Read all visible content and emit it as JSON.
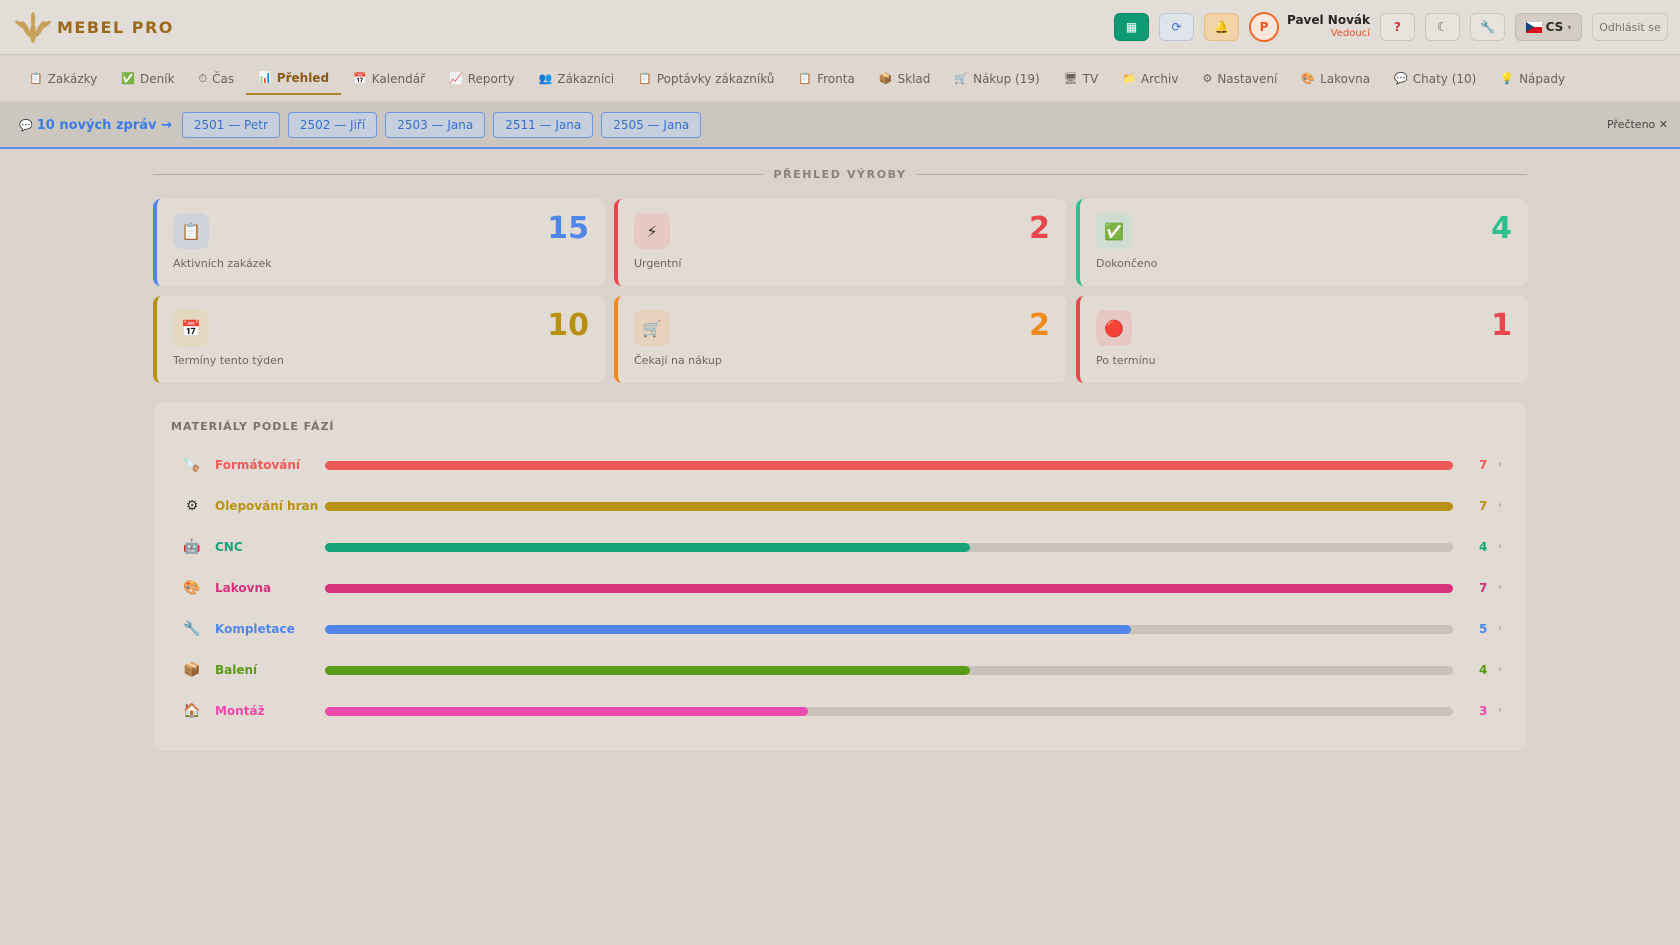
{
  "app": {
    "name": "MEBEL PRO",
    "brand_color": "#9a6a1e"
  },
  "header": {
    "buttons": [
      {
        "icon": "display-icon",
        "glyph": "▦"
      },
      {
        "icon": "refresh-icon",
        "glyph": "⟳"
      },
      {
        "icon": "bell-icon",
        "glyph": "🔔"
      },
      {
        "icon": "help-icon",
        "glyph": "?"
      },
      {
        "icon": "moon-icon",
        "glyph": "☾"
      },
      {
        "icon": "wrench-icon",
        "glyph": "🔧"
      }
    ],
    "avatar_initial": "P",
    "user_name": "Pavel Novák",
    "user_role": "Vedoucí",
    "language": "CS",
    "logout_label": "Odhlásit se"
  },
  "nav": {
    "items": [
      {
        "label": "Zakázky",
        "icon": "clipboard-icon",
        "glyph": "📋",
        "active": false
      },
      {
        "label": "Deník",
        "icon": "check-icon",
        "glyph": "✅",
        "active": false
      },
      {
        "label": "Čas",
        "icon": "clock-icon",
        "glyph": "⏱",
        "active": false
      },
      {
        "label": "Přehled",
        "icon": "bar-chart-icon",
        "glyph": "📊",
        "active": true
      },
      {
        "label": "Kalendář",
        "icon": "calendar-icon",
        "glyph": "📅",
        "active": false
      },
      {
        "label": "Reporty",
        "icon": "line-chart-icon",
        "glyph": "📈",
        "active": false
      },
      {
        "label": "Zákazníci",
        "icon": "people-icon",
        "glyph": "👥",
        "active": false
      },
      {
        "label": "Poptávky zákazníků",
        "icon": "clipboard-icon",
        "glyph": "📋",
        "active": false
      },
      {
        "label": "Fronta",
        "icon": "clipboard-icon",
        "glyph": "📋",
        "active": false
      },
      {
        "label": "Sklad",
        "icon": "box-icon",
        "glyph": "📦",
        "active": false
      },
      {
        "label": "Nákup (19)",
        "icon": "cart-icon",
        "glyph": "🛒",
        "active": false
      },
      {
        "label": "TV",
        "icon": "tv-icon",
        "glyph": "🖥",
        "active": false
      },
      {
        "label": "Archiv",
        "icon": "folder-icon",
        "glyph": "📁",
        "active": false
      },
      {
        "label": "Nastavení",
        "icon": "gear-icon",
        "glyph": "⚙",
        "active": false
      },
      {
        "label": "Lakovna",
        "icon": "paint-icon",
        "glyph": "🎨",
        "active": false
      },
      {
        "label": "Chaty (10)",
        "icon": "chat-icon",
        "glyph": "💬",
        "active": false
      },
      {
        "label": "Nápady",
        "icon": "lightbulb-icon",
        "glyph": "💡",
        "active": false
      }
    ]
  },
  "messages": {
    "link": "10 nových zpráv →",
    "chips": [
      "2501 — Petr",
      "2502 — Jiří",
      "2503 — Jana",
      "2511 — Jana",
      "2505 — Jana"
    ],
    "read_label": "Přečteno ✕"
  },
  "overview": {
    "title": "PŘEHLED VÝROBY",
    "cards": [
      {
        "value": "15",
        "label": "Aktivních zakázek",
        "icon": "clipboard-icon",
        "glyph": "📋",
        "color": "#4f86e8",
        "icon_bg": "#cfd3da"
      },
      {
        "value": "2",
        "label": "Urgentní",
        "icon": "lightning-icon",
        "glyph": "⚡",
        "color": "#e8474b",
        "icon_bg": "#e7c9c4"
      },
      {
        "value": "4",
        "label": "Dokončeno",
        "icon": "check-icon",
        "glyph": "✅",
        "color": "#2fc08f",
        "icon_bg": "#cfdcd2"
      },
      {
        "value": "10",
        "label": "Termíny tento týden",
        "icon": "calendar-icon",
        "glyph": "📅",
        "color": "#b8920f",
        "icon_bg": "#e3d7c0"
      },
      {
        "value": "2",
        "label": "Čekají na nákup",
        "icon": "cart-icon",
        "glyph": "🛒",
        "color": "#f08a1c",
        "icon_bg": "#e7d3bd"
      },
      {
        "value": "1",
        "label": "Po termínu",
        "icon": "red-circle-icon",
        "glyph": "🔴",
        "color": "#e8474b",
        "icon_bg": "#e7c9c4"
      }
    ]
  },
  "materials": {
    "title": "MATERIÁLY PODLE FÁZÍ",
    "max": 7,
    "phases": [
      {
        "label": "Formátování",
        "count": 7,
        "icon": "saw-icon",
        "glyph": "🪚",
        "color": "#ef5a5a"
      },
      {
        "label": "Olepování hran",
        "count": 7,
        "icon": "gear-icon",
        "glyph": "⚙",
        "color": "#b8920f"
      },
      {
        "label": "CNC",
        "count": 4,
        "icon": "robot-icon",
        "glyph": "🤖",
        "color": "#17a37a"
      },
      {
        "label": "Lakovna",
        "count": 7,
        "icon": "paint-icon",
        "glyph": "🎨",
        "color": "#d6337c"
      },
      {
        "label": "Kompletace",
        "count": 5,
        "icon": "wrench-icon",
        "glyph": "🔧",
        "color": "#4f86e8"
      },
      {
        "label": "Balení",
        "count": 4,
        "icon": "box-icon",
        "glyph": "📦",
        "color": "#5a9a17"
      },
      {
        "label": "Montáž",
        "count": 3,
        "icon": "house-icon",
        "glyph": "🏠",
        "color": "#f04aae"
      }
    ]
  }
}
